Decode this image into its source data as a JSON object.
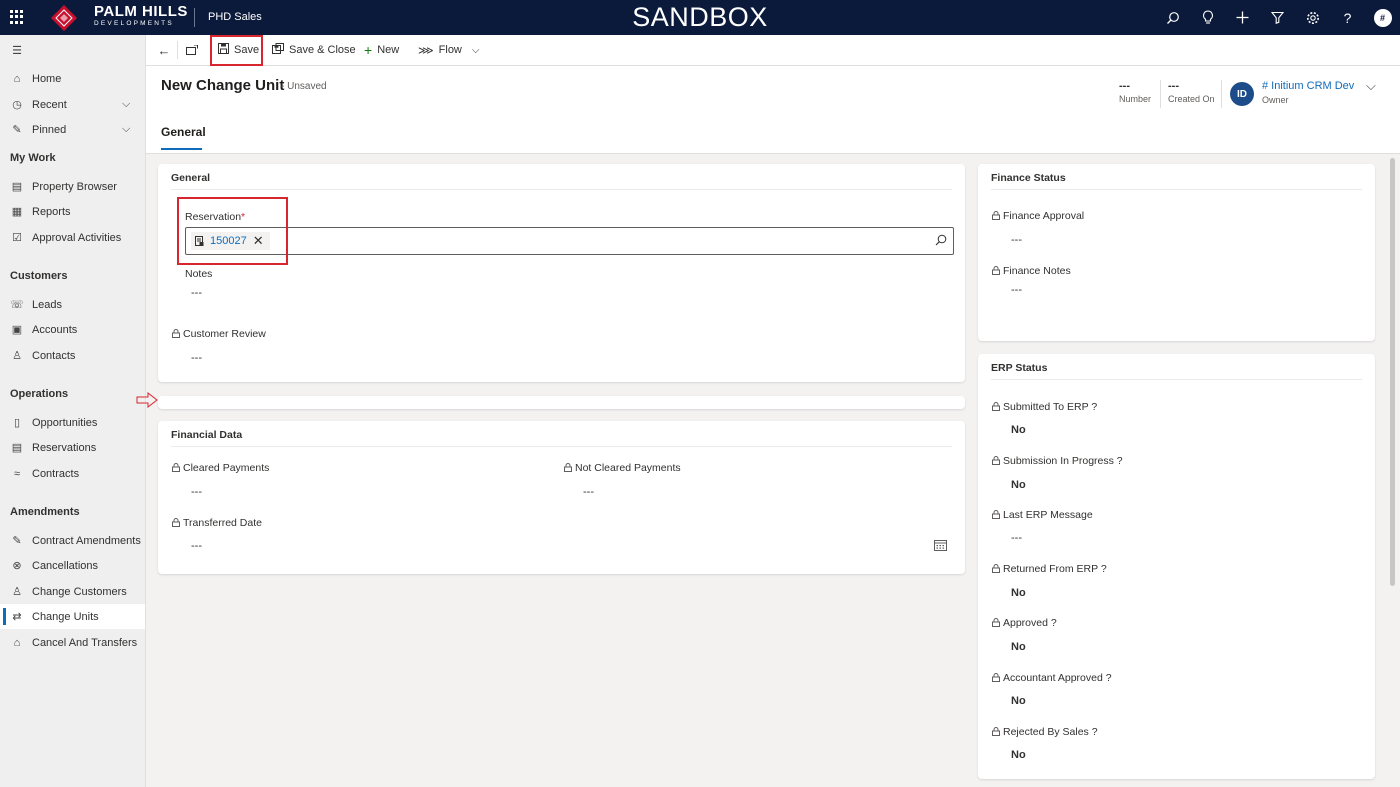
{
  "topbar": {
    "brand_name": "PALM HILLS",
    "brand_sub": "DEVELOPMENTS",
    "app_name": "PHD Sales",
    "environment": "SANDBOX",
    "user_initial": "#"
  },
  "sidebar": {
    "home": "Home",
    "recent": "Recent",
    "pinned": "Pinned",
    "sections": {
      "my_work": "My Work",
      "customers": "Customers",
      "operations": "Operations",
      "amendments": "Amendments"
    },
    "my_work_items": [
      "Property Browser",
      "Reports",
      "Approval Activities"
    ],
    "customers_items": [
      "Leads",
      "Accounts",
      "Contacts"
    ],
    "operations_items": [
      "Opportunities",
      "Reservations",
      "Contracts"
    ],
    "amendments_items": [
      "Contract Amendments",
      "Cancellations",
      "Change Customers",
      "Change Units",
      "Cancel And Transfers"
    ],
    "active_item": "Change Units"
  },
  "commandbar": {
    "save": "Save",
    "save_close": "Save & Close",
    "new": "New",
    "flow": "Flow"
  },
  "header": {
    "title": "New Change Unit",
    "status": "- Unsaved",
    "number_value": "---",
    "number_label": "Number",
    "created_value": "---",
    "created_label": "Created On",
    "owner_initials": "ID",
    "owner_name": "# Initium CRM Dev",
    "owner_label": "Owner",
    "tab": "General"
  },
  "general": {
    "title": "General",
    "reservation_label": "Reservation",
    "required_mark": "*",
    "reservation_value": "150027",
    "notes_label": "Notes",
    "notes_value": "---",
    "customer_review_label": "Customer Review",
    "customer_review_value": "---"
  },
  "financial": {
    "title": "Financial Data",
    "cleared_label": "Cleared Payments",
    "cleared_value": "---",
    "not_cleared_label": "Not Cleared Payments",
    "not_cleared_value": "---",
    "transferred_label": "Transferred Date",
    "transferred_value": "---"
  },
  "finance_status": {
    "title": "Finance Status",
    "approval_label": "Finance Approval",
    "approval_value": "---",
    "notes_label": "Finance Notes",
    "notes_value": "---"
  },
  "erp_status": {
    "title": "ERP Status",
    "fields": [
      {
        "label": "Submitted To ERP ?",
        "value": "No"
      },
      {
        "label": "Submission In Progress ?",
        "value": "No"
      },
      {
        "label": "Last ERP Message",
        "value": "---"
      },
      {
        "label": "Returned From ERP ?",
        "value": "No"
      },
      {
        "label": "Approved ?",
        "value": "No"
      },
      {
        "label": "Accountant Approved ?",
        "value": "No"
      },
      {
        "label": "Rejected By Sales ?",
        "value": "No"
      }
    ]
  },
  "colors": {
    "topbar": "#0b1a3a",
    "accent": "#0f6cbd",
    "highlight": "#d7262e"
  }
}
